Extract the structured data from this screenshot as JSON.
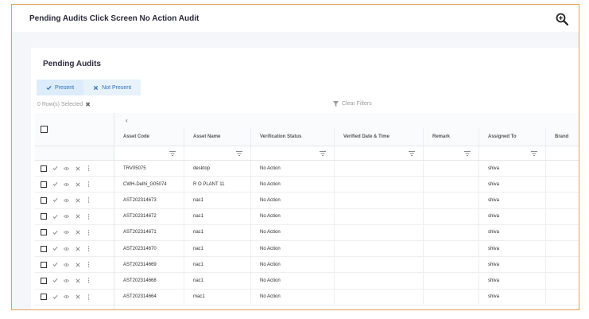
{
  "header": {
    "title": "Pending Audits Click Screen No Action Audit",
    "zoom_icon": "zoom-in-icon"
  },
  "card": {
    "title": "Pending Audits"
  },
  "toggles": [
    {
      "label": "Present",
      "icon": "check-icon"
    },
    {
      "label": "Not Present",
      "icon": "close-icon"
    }
  ],
  "selection": {
    "text": "0 Row(s) Selected"
  },
  "filters": {
    "clear_label": "Clear Filters"
  },
  "table": {
    "columns": [
      "Asset Code",
      "Asset Name",
      "Verification Status",
      "Verified Date & Time",
      "Remark",
      "Assigned To",
      "Brand"
    ],
    "rows": [
      {
        "code": "TRV05075",
        "name": "desktop",
        "status": "No Action",
        "verified": "",
        "remark": "",
        "assigned": "shiva",
        "brand": ""
      },
      {
        "code": "CWH-Delhi_G05074",
        "name": "R O PLANT 11",
        "status": "No Action",
        "verified": "",
        "remark": "",
        "assigned": "shiva",
        "brand": ""
      },
      {
        "code": "AST202314673",
        "name": "nac1",
        "status": "No Action",
        "verified": "",
        "remark": "",
        "assigned": "shiva",
        "brand": ""
      },
      {
        "code": "AST202314672",
        "name": "nac1",
        "status": "No Action",
        "verified": "",
        "remark": "",
        "assigned": "shiva",
        "brand": ""
      },
      {
        "code": "AST202314671",
        "name": "nac1",
        "status": "No Action",
        "verified": "",
        "remark": "",
        "assigned": "shiva",
        "brand": ""
      },
      {
        "code": "AST202314670",
        "name": "nac1",
        "status": "No Action",
        "verified": "",
        "remark": "",
        "assigned": "shiva",
        "brand": ""
      },
      {
        "code": "AST202314669",
        "name": "nac1",
        "status": "No Action",
        "verified": "",
        "remark": "",
        "assigned": "shiva",
        "brand": ""
      },
      {
        "code": "AST202314668",
        "name": "nac1",
        "status": "No Action",
        "verified": "",
        "remark": "",
        "assigned": "shiva",
        "brand": ""
      },
      {
        "code": "AST202314664",
        "name": "mac1",
        "status": "No Action",
        "verified": "",
        "remark": "",
        "assigned": "shiva",
        "brand": ""
      }
    ]
  },
  "colors": {
    "accent": "#2d6fbd",
    "frame_border": "#e0a15a",
    "background": "#f4f6f9"
  }
}
